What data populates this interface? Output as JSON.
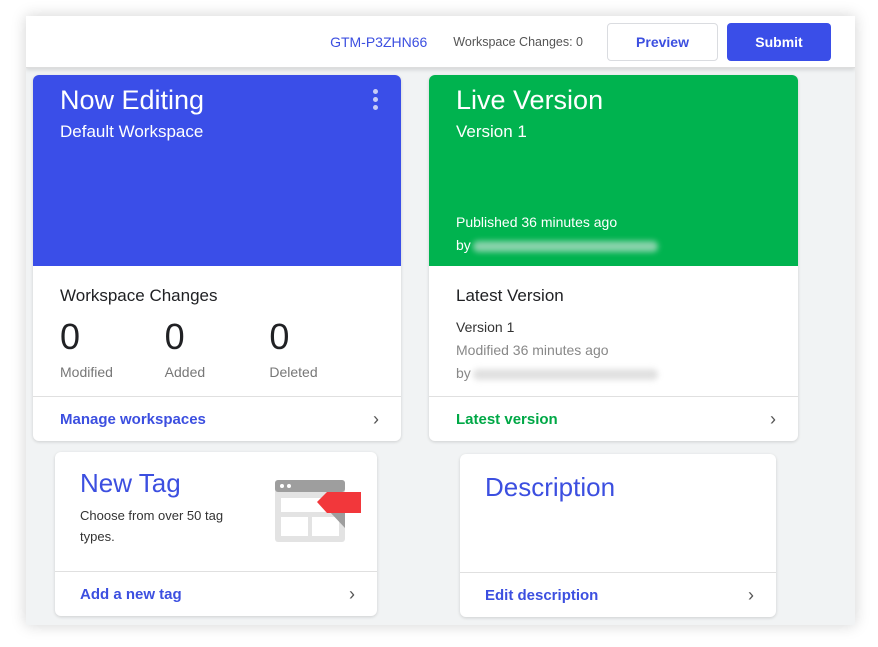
{
  "topbar": {
    "container_id": "GTM-P3ZHN66",
    "workspace_changes": "Workspace Changes: 0",
    "preview": "Preview",
    "submit": "Submit"
  },
  "now_editing": {
    "title": "Now Editing",
    "workspace": "Default Workspace",
    "changes_title": "Workspace Changes",
    "stats": [
      {
        "value": "0",
        "label": "Modified"
      },
      {
        "value": "0",
        "label": "Added"
      },
      {
        "value": "0",
        "label": "Deleted"
      }
    ],
    "link": "Manage workspaces"
  },
  "live": {
    "title": "Live Version",
    "version": "Version 1",
    "published": "Published 36 minutes ago",
    "by": "by",
    "latest_title": "Latest Version",
    "latest_version": "Version 1",
    "modified": "Modified 36 minutes ago",
    "link": "Latest version"
  },
  "new_tag": {
    "title": "New Tag",
    "desc": "Choose from over 50 tag types.",
    "link": "Add a new tag"
  },
  "description": {
    "title": "Description",
    "link": "Edit description"
  },
  "colors": {
    "accent": "#3a4ee8",
    "live": "#00b34f",
    "tag_red": "#f2373b"
  }
}
